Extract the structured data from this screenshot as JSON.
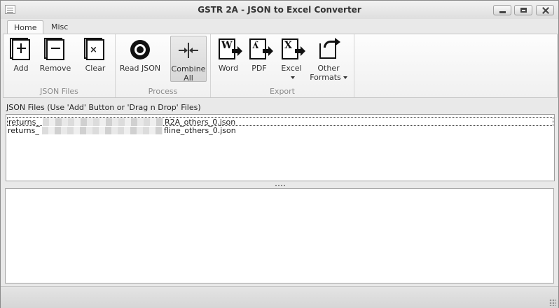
{
  "window": {
    "title": "GSTR 2A - JSON to Excel Converter",
    "icons": {
      "app": "app-window-icon",
      "minimize": "minimize-icon",
      "maximize": "maximize-icon",
      "close": "close-icon"
    }
  },
  "tabs": [
    {
      "label": "Home",
      "active": true
    },
    {
      "label": "Misc",
      "active": false
    }
  ],
  "ribbon": {
    "groups": {
      "json_files": {
        "label": "JSON Files"
      },
      "process": {
        "label": "Process"
      },
      "export": {
        "label": "Export"
      }
    },
    "buttons": {
      "add": {
        "label": "Add",
        "icon": "add-file-icon"
      },
      "remove": {
        "label": "Remove",
        "icon": "remove-file-icon"
      },
      "clear": {
        "label": "Clear",
        "icon": "clear-list-icon"
      },
      "read_json": {
        "label": "Read JSON",
        "icon": "refresh-icon"
      },
      "combine_all": {
        "line1": "Combine",
        "line2": "All",
        "icon": "combine-icon"
      },
      "word": {
        "label": "Word",
        "icon": "word-export-icon"
      },
      "pdf": {
        "label": "PDF",
        "icon": "pdf-export-icon"
      },
      "excel": {
        "label": "Excel",
        "icon": "excel-export-icon"
      },
      "other_formats": {
        "line1": "Other",
        "line2": "Formats",
        "icon": "share-export-icon"
      }
    }
  },
  "json_files_panel": {
    "header": "JSON Files (Use 'Add' Button or 'Drag n Drop' Files)",
    "files": [
      {
        "prefix": "returns_",
        "suffix": "R2A_others_0.json"
      },
      {
        "prefix": "returns_",
        "suffix": "fline_others_0.json"
      }
    ]
  }
}
